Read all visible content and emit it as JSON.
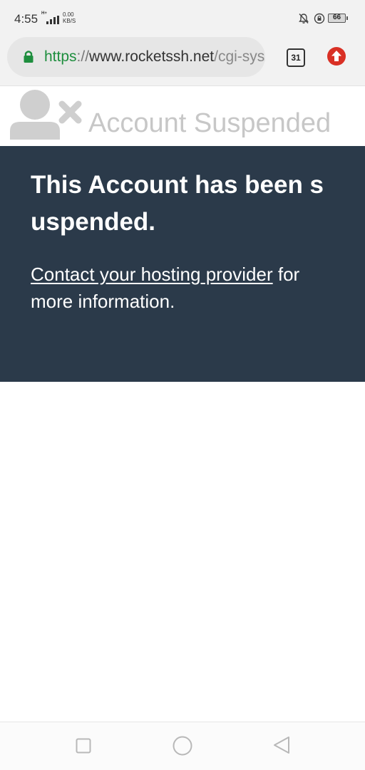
{
  "status_bar": {
    "time": "4:55",
    "network_type": "H+",
    "speed_value": "0.00",
    "speed_unit": "KB/S",
    "battery": "66"
  },
  "browser": {
    "url_scheme": "https",
    "url_separator": "://",
    "url_host": "www.rocketssh.net",
    "url_path": "/cgi-sys/suspendedpage.cgi",
    "tab_count": "31"
  },
  "page": {
    "header_title": "Account Suspended",
    "heading": "This Account has been suspended.",
    "contact_link": "Contact your hosting provider",
    "contact_rest": " for more information."
  },
  "colors": {
    "panel": "#2b3a4a",
    "secure_green": "#1e8e3e",
    "update_red": "#d93025"
  }
}
